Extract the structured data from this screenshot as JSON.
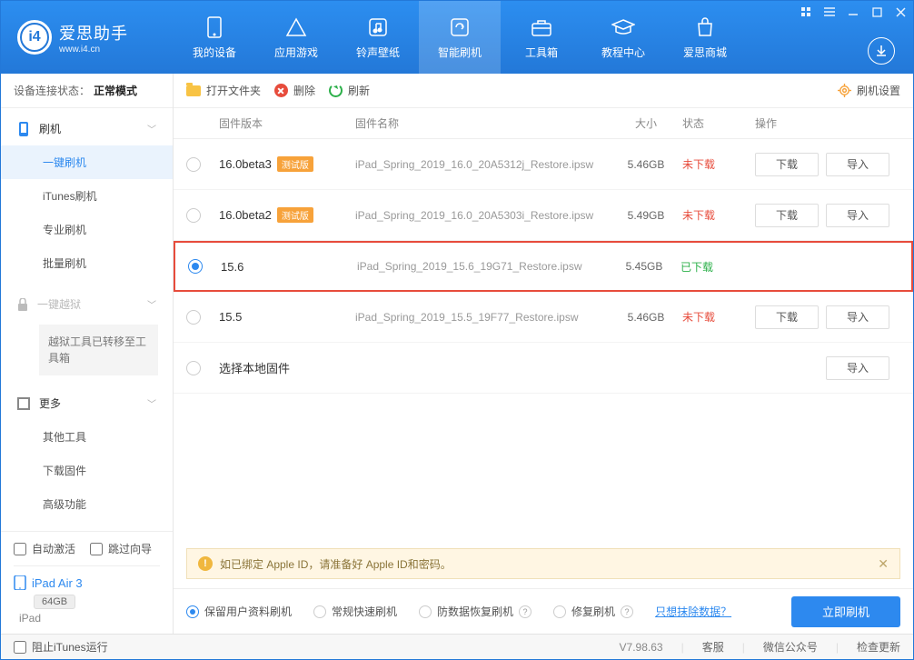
{
  "app": {
    "name": "爱思助手",
    "url": "www.i4.cn"
  },
  "nav": [
    {
      "label": "我的设备"
    },
    {
      "label": "应用游戏"
    },
    {
      "label": "铃声壁纸"
    },
    {
      "label": "智能刷机"
    },
    {
      "label": "工具箱"
    },
    {
      "label": "教程中心"
    },
    {
      "label": "爱思商城"
    }
  ],
  "status": {
    "label": "设备连接状态：",
    "value": "正常模式"
  },
  "sidebar": {
    "flash": {
      "head": "刷机",
      "items": [
        "一键刷机",
        "iTunes刷机",
        "专业刷机",
        "批量刷机"
      ]
    },
    "jail": {
      "head": "一键越狱",
      "note": "越狱工具已转移至工具箱"
    },
    "more": {
      "head": "更多",
      "items": [
        "其他工具",
        "下载固件",
        "高级功能"
      ]
    }
  },
  "bottom": {
    "auto_activate": "自动激活",
    "skip_guide": "跳过向导"
  },
  "device": {
    "name": "iPad Air 3",
    "capacity": "64GB",
    "type": "iPad"
  },
  "toolbar": {
    "open": "打开文件夹",
    "delete": "删除",
    "refresh": "刷新",
    "settings": "刷机设置"
  },
  "columns": {
    "version": "固件版本",
    "name": "固件名称",
    "size": "大小",
    "status": "状态",
    "actions": "操作"
  },
  "rows": [
    {
      "version": "16.0beta3",
      "beta": "测试版",
      "name": "iPad_Spring_2019_16.0_20A5312j_Restore.ipsw",
      "size": "5.46GB",
      "status": "未下载",
      "downloaded": false,
      "selected": false
    },
    {
      "version": "16.0beta2",
      "beta": "测试版",
      "name": "iPad_Spring_2019_16.0_20A5303i_Restore.ipsw",
      "size": "5.49GB",
      "status": "未下载",
      "downloaded": false,
      "selected": false
    },
    {
      "version": "15.6",
      "beta": "",
      "name": "iPad_Spring_2019_15.6_19G71_Restore.ipsw",
      "size": "5.45GB",
      "status": "已下载",
      "downloaded": true,
      "selected": true
    },
    {
      "version": "15.5",
      "beta": "",
      "name": "iPad_Spring_2019_15.5_19F77_Restore.ipsw",
      "size": "5.46GB",
      "status": "未下载",
      "downloaded": false,
      "selected": false
    }
  ],
  "local_row": "选择本地固件",
  "buttons": {
    "download": "下载",
    "import": "导入"
  },
  "warning": "如已绑定 Apple ID，请准备好 Apple ID和密码。",
  "options": {
    "keep": "保留用户资料刷机",
    "fast": "常规快速刷机",
    "anti": "防数据恢复刷机",
    "repair": "修复刷机",
    "link": "只想抹除数据？",
    "flash": "立即刷机"
  },
  "footer": {
    "block_itunes": "阻止iTunes运行",
    "version": "V7.98.63",
    "service": "客服",
    "wechat": "微信公众号",
    "update": "检查更新"
  }
}
